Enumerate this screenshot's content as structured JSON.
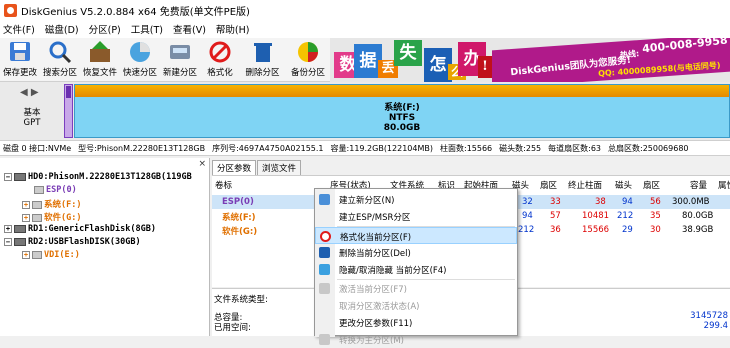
{
  "window": {
    "title": "DiskGenius V5.2.0.884 x64 免费版(单文件PE版)"
  },
  "menu": [
    "文件(F)",
    "磁盘(D)",
    "分区(P)",
    "工具(T)",
    "查看(V)",
    "帮助(H)"
  ],
  "toolbar": [
    {
      "label": "保存更改",
      "icon": "save-icon"
    },
    {
      "label": "搜索分区",
      "icon": "search-icon"
    },
    {
      "label": "恢复文件",
      "icon": "recover-icon"
    },
    {
      "label": "快速分区",
      "icon": "quick-partition-icon"
    },
    {
      "label": "新建分区",
      "icon": "new-partition-icon"
    },
    {
      "label": "格式化",
      "icon": "format-icon"
    },
    {
      "label": "删除分区",
      "icon": "delete-icon"
    },
    {
      "label": "备份分区",
      "icon": "backup-icon"
    }
  ],
  "banner": {
    "chars": [
      "数",
      "据",
      "丢",
      "失",
      "怎",
      "么",
      "办",
      "!"
    ],
    "team": "DiskGenius团队为您服务!",
    "phone": "400-008-9958",
    "phone_prefix": "热线:",
    "qq": "QQ: 4000089958(与电话同号)"
  },
  "disk_panel": {
    "nav": "◀ ▶",
    "kind_line1": "基本",
    "kind_line2": "GPT",
    "partition_name": "系统(F:)",
    "partition_fs": "NTFS",
    "partition_size": "80.0GB"
  },
  "diskinfo": [
    "磁盘 0 接口:NVMe",
    "型号:PhisonM.22280E13T128GB",
    "序列号:4697A4750A02155.1",
    "容量:119.2GB(122104MB)",
    "柱面数:15566",
    "磁头数:255",
    "每道扇区数:63",
    "总扇区数:250069680"
  ],
  "tree": {
    "close": "×",
    "disks": [
      {
        "label": "HD0:PhisonM.22280E13T128GB(119GB",
        "parts": [
          {
            "label": "ESP(0)",
            "color": "purple"
          },
          {
            "label": "系统(F:)",
            "color": "orange"
          },
          {
            "label": "软件(G:)",
            "color": "orange"
          }
        ]
      },
      {
        "label": "RD1:GenericFlashDisk(8GB)",
        "parts": []
      },
      {
        "label": "RD2:USBFlashDISK(30GB)",
        "parts": [
          {
            "label": "VDI(E:)",
            "color": "orange"
          }
        ]
      }
    ]
  },
  "tabs": [
    "分区参数",
    "浏览文件"
  ],
  "grid": {
    "headers": [
      "卷标",
      "序号(状态)",
      "文件系统",
      "标识",
      "起始柱面",
      "磁头",
      "扇区",
      "终止柱面",
      "磁头",
      "扇区",
      "容量",
      "属性"
    ],
    "rows": [
      {
        "label": "ESP(0)",
        "cells": [
          "32",
          "33",
          "38",
          "94",
          "56",
          "300.0MB"
        ],
        "selected": true
      },
      {
        "label": "系统(F:)",
        "cells": [
          "94",
          "57",
          "10481",
          "212",
          "35",
          "80.0GB"
        ],
        "selected": false
      },
      {
        "label": "软件(G:)",
        "cells": [
          "212",
          "36",
          "15566",
          "29",
          "30",
          "38.9GB"
        ],
        "selected": false
      }
    ]
  },
  "lower": {
    "fs_type": "文件系统类型:",
    "total": "总容量:",
    "used": "已用空间:",
    "right1": "3145728",
    "right2": "299.4"
  },
  "context_menu": [
    {
      "label": "建立新分区(N)",
      "icon": "new-partition-icon",
      "disabled": false,
      "highlight": false
    },
    {
      "label": "建立ESP/MSR分区",
      "icon": "",
      "disabled": false,
      "highlight": false
    },
    {
      "label": "格式化当前分区(F)",
      "icon": "format-icon",
      "disabled": false,
      "highlight": true
    },
    {
      "label": "删除当前分区(Del)",
      "icon": "delete-icon",
      "disabled": false,
      "highlight": false
    },
    {
      "label": "隐藏/取消隐藏 当前分区(F4)",
      "icon": "hide-icon",
      "disabled": false,
      "highlight": false
    },
    {
      "label": "激活当前分区(F7)",
      "icon": "activate-icon",
      "disabled": true,
      "highlight": false
    },
    {
      "label": "取消分区激活状态(A)",
      "icon": "",
      "disabled": true,
      "highlight": false
    },
    {
      "label": "更改分区参数(F11)",
      "icon": "",
      "disabled": false,
      "highlight": false
    },
    {
      "label": "转换为主分区(M)",
      "icon": "convert-icon",
      "disabled": true,
      "highlight": false
    }
  ]
}
